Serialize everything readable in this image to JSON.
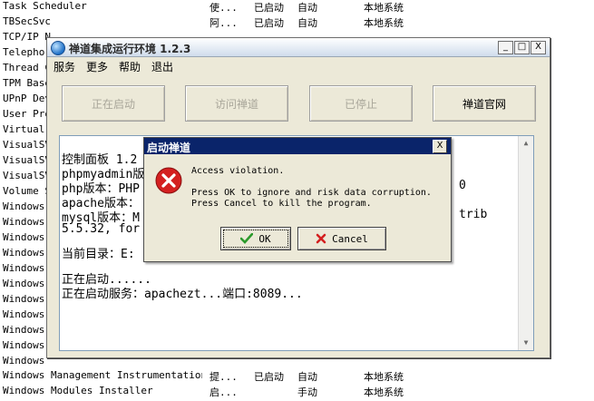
{
  "services": [
    {
      "name": "Task Scheduler",
      "desc": "使...",
      "status": "已启动",
      "startup": "自动",
      "logon": "本地系统"
    },
    {
      "name": "TBSecSvc",
      "desc": "阿...",
      "status": "已启动",
      "startup": "自动",
      "logon": "本地系统"
    },
    {
      "name": "TCP/IP N",
      "desc": "",
      "status": "",
      "startup": "",
      "logon": ""
    },
    {
      "name": "Telephor",
      "desc": "",
      "status": "",
      "startup": "",
      "logon": ""
    },
    {
      "name": "Thread C",
      "desc": "",
      "status": "",
      "startup": "",
      "logon": ""
    },
    {
      "name": "TPM Base",
      "desc": "",
      "status": "",
      "startup": "",
      "logon": ""
    },
    {
      "name": "UPnP Dev",
      "desc": "",
      "status": "",
      "startup": "",
      "logon": ""
    },
    {
      "name": "User Pro",
      "desc": "",
      "status": "",
      "startup": "",
      "logon": ""
    },
    {
      "name": "Virtual",
      "desc": "",
      "status": "",
      "startup": "",
      "logon": ""
    },
    {
      "name": "VisualSV",
      "desc": "",
      "status": "",
      "startup": "",
      "logon": ""
    },
    {
      "name": "VisualSV",
      "desc": "",
      "status": "",
      "startup": "",
      "logon": ""
    },
    {
      "name": "VisualSV",
      "desc": "",
      "status": "",
      "startup": "",
      "logon": ""
    },
    {
      "name": "Volume S",
      "desc": "",
      "status": "",
      "startup": "",
      "logon": ""
    },
    {
      "name": "Windows",
      "desc": "",
      "status": "",
      "startup": "",
      "logon": ""
    },
    {
      "name": "Windows",
      "desc": "",
      "status": "",
      "startup": "",
      "logon": ""
    },
    {
      "name": "Windows",
      "desc": "",
      "status": "",
      "startup": "",
      "logon": ""
    },
    {
      "name": "Windows",
      "desc": "",
      "status": "",
      "startup": "",
      "logon": ""
    },
    {
      "name": "Windows",
      "desc": "",
      "status": "",
      "startup": "",
      "logon": ""
    },
    {
      "name": "Windows",
      "desc": "",
      "status": "",
      "startup": "",
      "logon": ""
    },
    {
      "name": "Windows",
      "desc": "",
      "status": "",
      "startup": "",
      "logon": ""
    },
    {
      "name": "Windows",
      "desc": "",
      "status": "",
      "startup": "",
      "logon": ""
    },
    {
      "name": "Windows",
      "desc": "",
      "status": "",
      "startup": "",
      "logon": ""
    },
    {
      "name": "Windows",
      "desc": "",
      "status": "",
      "startup": "",
      "logon": ""
    },
    {
      "name": "Windows",
      "desc": "",
      "status": "",
      "startup": "",
      "logon": ""
    },
    {
      "name": "Windows Management Instrumentation",
      "desc": "提...",
      "status": "已启动",
      "startup": "自动",
      "logon": "本地系统"
    },
    {
      "name": "Windows Modules Installer",
      "desc": "启...",
      "status": "",
      "startup": "手动",
      "logon": "本地系统"
    }
  ],
  "app": {
    "title": "禅道集成运行环境 1.2.3",
    "controls": {
      "minimize": "_",
      "maximize": "□",
      "close": "X"
    },
    "menu": [
      "服务",
      "更多",
      "帮助",
      "退出"
    ],
    "buttons": [
      {
        "label": "正在启动",
        "enabled": false
      },
      {
        "label": "访问禅道",
        "enabled": false
      },
      {
        "label": "已停止",
        "enabled": false
      },
      {
        "label": "禅道官网",
        "enabled": true
      }
    ],
    "log": [
      "控制面板 1.2",
      "phpmyadmin版",
      "php版本：PHP",
      "apache版本：",
      "mysql版本：M",
      "5.5.32, for",
      "",
      "当前目录：E:",
      "",
      "正在启动......",
      "正在启动服务：apachezt...端口:8089..."
    ],
    "log_tail": {
      "line3": "0",
      "line5": "trib"
    }
  },
  "dialog": {
    "title": "启动禅道",
    "close": "X",
    "icon": "error-icon",
    "message": [
      "Access violation.",
      "",
      "Press OK to ignore and risk data corruption.",
      "Press Cancel to kill the program."
    ],
    "ok_label": "OK",
    "cancel_label": "Cancel"
  }
}
